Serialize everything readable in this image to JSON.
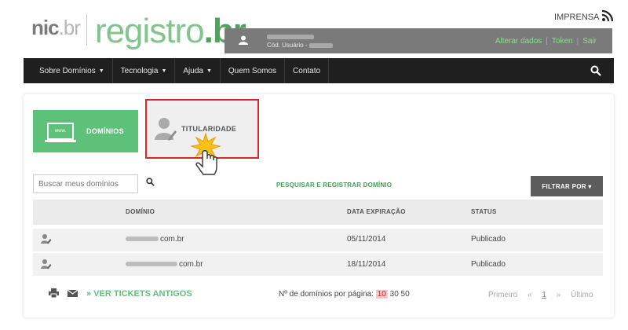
{
  "header": {
    "logo_nic": "nic",
    "logo_nic_br": ".br",
    "logo_registro": "registro",
    "logo_registro_br": ".br",
    "top_link": "IMPRENSA",
    "rss_icon": "rss-icon"
  },
  "userbar": {
    "code_label": "Cód. Usuário -",
    "links": [
      "Alterar dados",
      "Token",
      "Sair"
    ],
    "link_color": "#88e08a"
  },
  "nav": {
    "items": [
      {
        "label": "Sobre Domínios",
        "caret": true
      },
      {
        "label": "Tecnologia",
        "caret": true
      },
      {
        "label": "Ajuda",
        "caret": true
      },
      {
        "label": "Quem Somos",
        "caret": false
      },
      {
        "label": "Contato",
        "caret": false
      }
    ],
    "search_icon": "search-icon"
  },
  "tabs": {
    "dominios": {
      "label": "DOMÍNIOS",
      "icon_text": "www."
    },
    "titularidade": {
      "label": "TITULARIDADE"
    },
    "highlight_color": "#d9262b"
  },
  "toolbar": {
    "search_placeholder": "Buscar meus domínios",
    "register_link": "PESQUISAR E REGISTRAR DOMÍNIO",
    "filter_label": "FILTRAR POR ▾"
  },
  "table": {
    "headers": [
      "DOMÍNIO",
      "DATA EXPIRAÇÃO",
      "STATUS"
    ],
    "rows": [
      {
        "domain_suffix": "com.br",
        "expiry": "05/11/2014",
        "status": "Publicado"
      },
      {
        "domain_suffix": "com.br",
        "expiry": "18/11/2014",
        "status": "Publicado"
      }
    ]
  },
  "footer": {
    "tickets_link": "» VER TICKETS ANTIGOS",
    "per_page_label": "Nº de domínios por página:",
    "per_page_options": [
      "10",
      "30",
      "50"
    ],
    "per_page_selected": "10",
    "pager": {
      "first": "Primeiro",
      "prev": "«",
      "current": "1",
      "next": "»",
      "last": "Último"
    }
  },
  "colors": {
    "accent_green": "#5dc17a",
    "nav_bg": "#1f1f1f",
    "userbar_bg": "#7a7a7a"
  }
}
